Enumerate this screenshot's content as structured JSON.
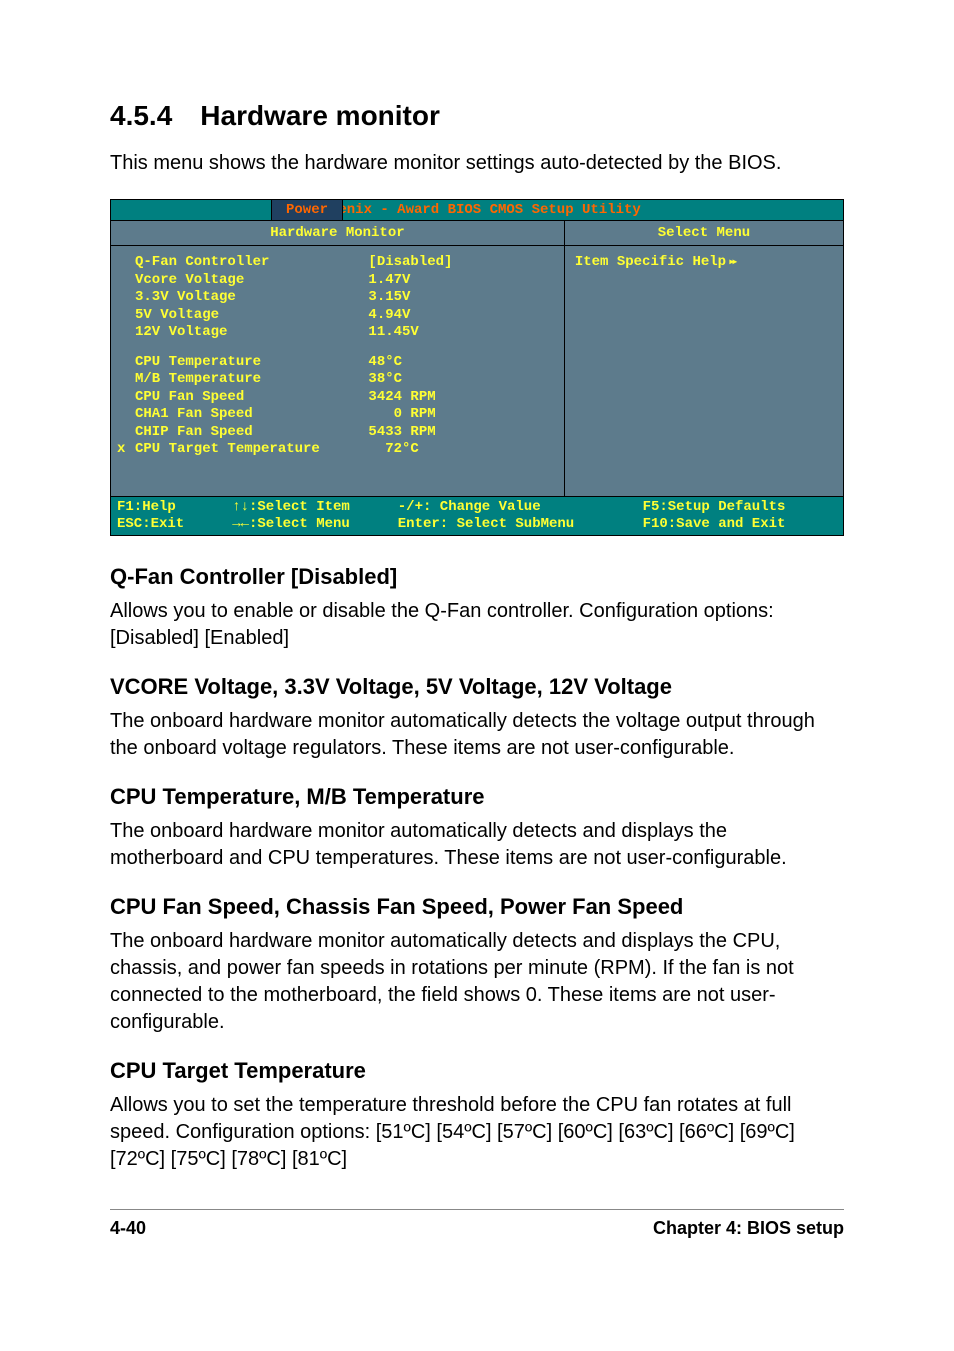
{
  "section": {
    "number": "4.5.4",
    "title": "Hardware monitor",
    "intro": "This menu shows the hardware monitor settings auto-detected by the BIOS."
  },
  "bios": {
    "title": "Phoenix - Award BIOS CMOS Setup Utility",
    "tab": "Power",
    "main_header": "Hardware Monitor",
    "side_header": "Select Menu",
    "help_text": "Item Specific Help",
    "rows": [
      {
        "label": "Q-Fan Controller",
        "value": "[Disabled]",
        "marker": ""
      },
      {
        "label": "Vcore Voltage",
        "value": "1.47V",
        "marker": ""
      },
      {
        "label": "3.3V Voltage",
        "value": "3.15V",
        "marker": ""
      },
      {
        "label": "5V Voltage",
        "value": "4.94V",
        "marker": ""
      },
      {
        "label": "12V Voltage",
        "value": "11.45V",
        "marker": ""
      },
      {
        "label": "CPU Temperature",
        "value": "48°C",
        "marker": "",
        "spaced": true
      },
      {
        "label": "M/B Temperature",
        "value": "38°C",
        "marker": ""
      },
      {
        "label": "CPU Fan Speed",
        "value": "3424 RPM",
        "marker": ""
      },
      {
        "label": "CHA1 Fan Speed",
        "value": "   0 RPM",
        "marker": ""
      },
      {
        "label": "CHIP Fan Speed",
        "value": "5433 RPM",
        "marker": ""
      },
      {
        "label": "CPU Target Temperature",
        "value": "  72°C",
        "marker": "x"
      }
    ],
    "footer": {
      "c0r0": "F1:Help",
      "c0r1": "ESC:Exit",
      "c1r0": "↑↓:Select Item",
      "c1r1": "→←:Select Menu",
      "c2r0": "-/+: Change Value",
      "c2r1": "Enter: Select SubMenu",
      "c3r0": "F5:Setup Defaults",
      "c3r1": "F10:Save and Exit"
    }
  },
  "sections": [
    {
      "heading": "Q-Fan Controller [Disabled]",
      "body": "Allows you to enable or disable the Q-Fan controller. Configuration options: [Disabled] [Enabled]"
    },
    {
      "heading": "VCORE Voltage, 3.3V Voltage, 5V Voltage, 12V Voltage",
      "body": "The onboard hardware monitor automatically detects the voltage output through the onboard voltage regulators. These items are not user-configurable."
    },
    {
      "heading": "CPU Temperature, M/B Temperature",
      "body": "The onboard hardware monitor automatically detects and displays the motherboard and CPU temperatures. These items are not user-configurable."
    },
    {
      "heading": "CPU Fan Speed, Chassis Fan Speed, Power Fan Speed",
      "body": "The onboard hardware monitor automatically detects and displays the CPU, chassis, and power fan speeds in rotations per minute (RPM). If the fan is not connected to the motherboard, the field shows 0. These items are not user-configurable."
    },
    {
      "heading": "CPU Target Temperature",
      "body": "Allows you to set the temperature threshold before the CPU fan rotates at full speed. Configuration options: [51ºC] [54ºC] [57ºC] [60ºC] [63ºC] [66ºC] [69ºC] [72ºC] [75ºC] [78ºC] [81ºC]"
    }
  ],
  "footer": {
    "page": "4-40",
    "chapter": "Chapter 4: BIOS setup"
  }
}
